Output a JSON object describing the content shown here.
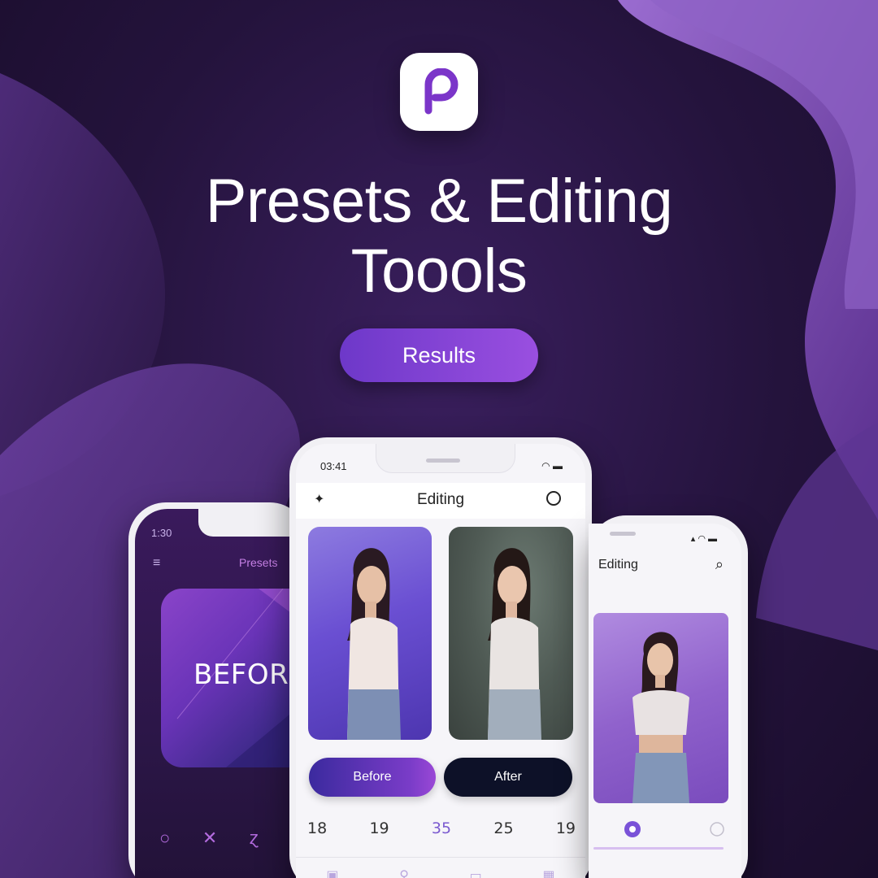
{
  "brand": {
    "icon_letter": "P",
    "accent": "#7b35c9",
    "accent_light": "#9a4fe0",
    "bg_dark": "#24133c"
  },
  "headline": {
    "line1": "Presets & Editing",
    "line2": "Toools"
  },
  "results_button": {
    "label": "Results"
  },
  "phone_left": {
    "status_time": "1:30",
    "menu_icon": "menu-icon",
    "title": "Presets",
    "card_text": "BEFORE",
    "tool_icons": [
      "circle-icon",
      "x-icon",
      "curve-icon",
      "leaf-icon"
    ]
  },
  "phone_center": {
    "status_time": "03:41",
    "title": "Editing",
    "back_icon": "back-icon",
    "action_icon": "circle-icon",
    "before_button": "Before",
    "after_button": "After",
    "values": [
      "18",
      "19",
      "35",
      "25",
      "19"
    ],
    "tab_icons": [
      "gallery-icon",
      "filter-icon",
      "crop-icon",
      "grid-icon"
    ]
  },
  "phone_right": {
    "title": "Editing",
    "search_icon": "search-icon"
  }
}
